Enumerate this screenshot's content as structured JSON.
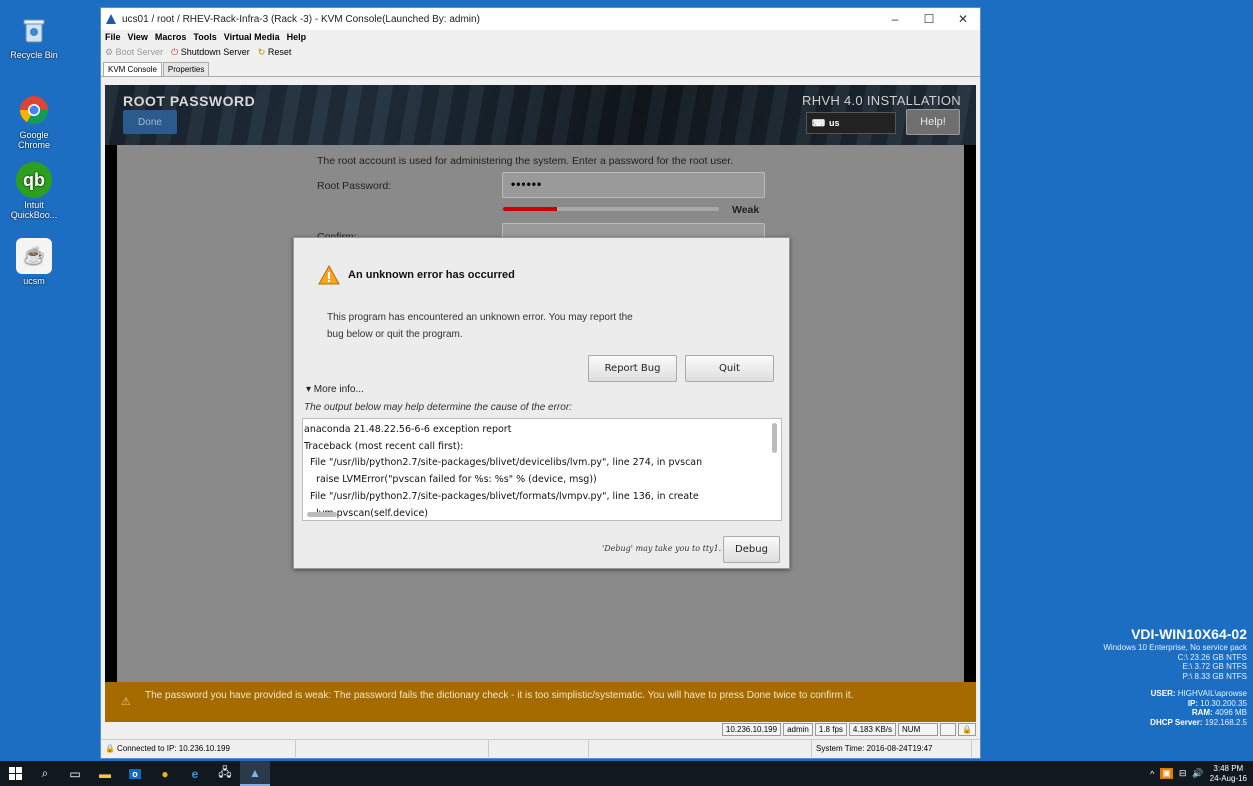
{
  "desktop": {
    "icons": [
      {
        "label": "Recycle Bin"
      },
      {
        "label": "Google Chrome"
      },
      {
        "label": "Intuit QuickBoo..."
      },
      {
        "label": "ucsm"
      }
    ]
  },
  "window": {
    "title": "ucs01 / root / RHEV-Rack-Infra-3 (Rack -3) - KVM Console(Launched By: admin)",
    "minimize": "–",
    "maximize": "☐",
    "close": "✕"
  },
  "menu": [
    "File",
    "View",
    "Macros",
    "Tools",
    "Virtual Media",
    "Help"
  ],
  "toolbar": {
    "boot": "Boot Server",
    "shutdown": "Shutdown Server",
    "reset": "Reset"
  },
  "tabs": [
    "KVM Console",
    "Properties"
  ],
  "installer": {
    "section_title": "ROOT PASSWORD",
    "done_label": "Done",
    "product_title": "RHVH 4.0 INSTALLATION",
    "keyboard": "us",
    "help_label": "Help!",
    "intro": "The root account is used for administering the system.  Enter a password for the root user.",
    "password_label": "Root Password:",
    "password_value": "••••••",
    "strength_label": "Weak",
    "strength_fraction": 0.25,
    "confirm_label": "Confirm:",
    "warning": "The password you have provided is weak: The password fails the dictionary check - it is too simplistic/systematic. You will have to press Done twice to confirm it."
  },
  "dialog": {
    "title": "An unknown error has occurred",
    "message": "This program has encountered an unknown error. You may report the bug below or quit the program.",
    "report_label": "Report Bug",
    "quit_label": "Quit",
    "more_info": "▾ More info...",
    "output_hint": "The output below may help determine the cause of the error:",
    "traceback": "anaconda 21.48.22.56-6-6 exception report\nTraceback (most recent call first):\n  File \"/usr/lib/python2.7/site-packages/blivet/devicelibs/lvm.py\", line 274, in pvscan\n    raise LVMError(\"pvscan failed for %s: %s\" % (device, msg))\n  File \"/usr/lib/python2.7/site-packages/blivet/formats/lvmpv.py\", line 136, in create\n    lvm.pvscan(self.device)",
    "debug_note": "'Debug' may take you to tty1.",
    "debug_label": "Debug"
  },
  "kvm_status": {
    "ip": "10.236.10.199",
    "user": "admin",
    "fps": "1.8 fps",
    "rate": "4.183 KB/s",
    "num": "NUM"
  },
  "kvm_bottom": {
    "connected": "Connected to IP: 10.236.10.199",
    "system_time": "System Time: 2016-08-24T19:47"
  },
  "bginfo": {
    "host": "VDI-WIN10X64-02",
    "os": "Windows 10 Enterprise, No service pack",
    "drive_c": "C:\\ 23.26 GB NTFS",
    "drive_e": "E:\\ 3.72 GB NTFS",
    "drive_p": "P:\\ 8.33 GB NTFS",
    "user_label": "USER:",
    "user": "HIGHVAIL\\aprowse",
    "ip_label": "IP:",
    "ip": "10.30.200.35",
    "ram_label": "RAM:",
    "ram": "4096 MB",
    "dhcp_label": "DHCP Server:",
    "dhcp": "192.168.2.5"
  },
  "taskbar": {
    "time": "3:48 PM",
    "date": "24-Aug-16"
  },
  "colors": {
    "desktop": "#1b6ec2",
    "warning_bar": "#a66b00",
    "strength_fill": "#cc0000"
  }
}
